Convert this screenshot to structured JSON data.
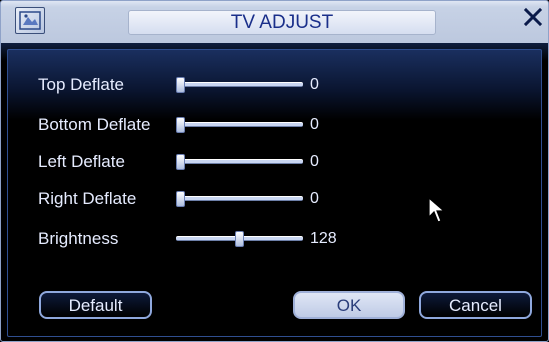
{
  "window": {
    "title": "TV ADJUST"
  },
  "sliders": [
    {
      "label": "Top Deflate",
      "value": "0",
      "fraction": 0
    },
    {
      "label": "Bottom Deflate",
      "value": "0",
      "fraction": 0
    },
    {
      "label": "Left Deflate",
      "value": "0",
      "fraction": 0
    },
    {
      "label": "Right Deflate",
      "value": "0",
      "fraction": 0
    },
    {
      "label": "Brightness",
      "value": "128",
      "fraction": 0.5
    }
  ],
  "buttons": {
    "default_label": "Default",
    "ok_label": "OK",
    "cancel_label": "Cancel"
  },
  "icons": [
    "logo-icon",
    "close-icon",
    "mouse-pointer-icon"
  ],
  "colors": {
    "title_text": "#1a2f8a",
    "label_text": "#e6ecff",
    "track": "#c9d6f2"
  }
}
